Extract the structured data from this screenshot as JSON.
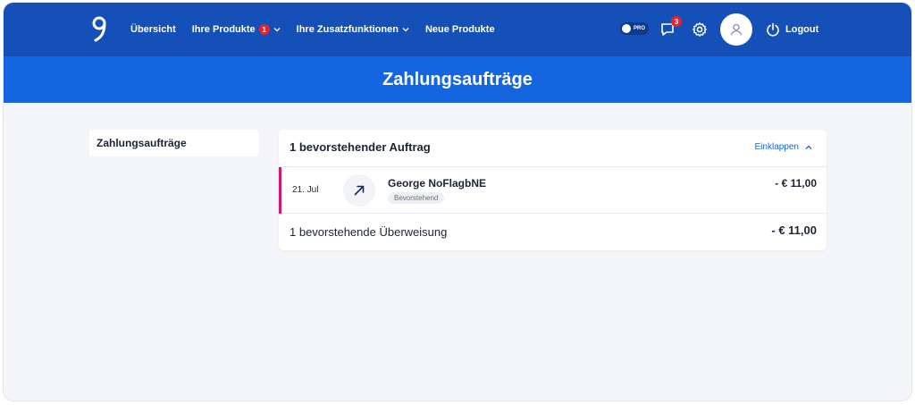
{
  "nav": {
    "items": [
      {
        "label": "Übersicht"
      },
      {
        "label": "Ihre Produkte",
        "badge": "1"
      },
      {
        "label": "Ihre Zusatzfunktionen"
      },
      {
        "label": "Neue Produkte"
      }
    ],
    "pro_label": "PRO",
    "messages_badge": "3",
    "logout_label": "Logout"
  },
  "page": {
    "title": "Zahlungsaufträge"
  },
  "sidebar": {
    "items": [
      {
        "label": "Zahlungsaufträge"
      }
    ]
  },
  "card": {
    "title": "1 bevorstehender Auftrag",
    "collapse_label": "Einklappen",
    "rows": [
      {
        "date": "21. Jul",
        "name": "George NoFlagbNE",
        "status": "Bevorstehend",
        "amount": "- € 11,00"
      }
    ],
    "footer": {
      "label": "1 bevorstehende Überweisung",
      "amount": "- € 11,00"
    }
  },
  "colors": {
    "topbar": "#1450b8",
    "banner": "#1565e0",
    "accent": "#1565e0",
    "badge": "#e3262e",
    "row_marker": "#d6196b"
  }
}
